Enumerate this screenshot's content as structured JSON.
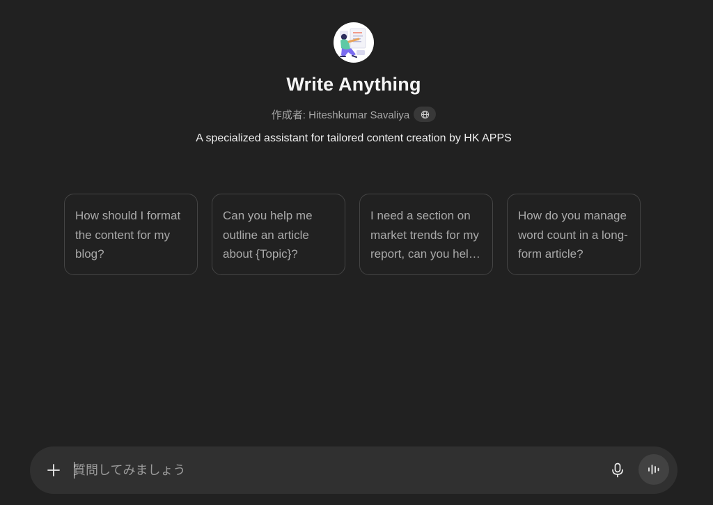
{
  "gpt": {
    "name": "Write Anything",
    "author": "作成者: Hiteshkumar Savaliya",
    "description": "A specialized assistant for tailored content creation by HK APPS",
    "avatar_icon": "writer-illustration-icon",
    "globe_icon": "globe-icon"
  },
  "starters": [
    {
      "text": "How should I format the content for my blog?"
    },
    {
      "text": "Can you help me outline an article about {Topic}?"
    },
    {
      "text": "I need a section on market trends for my report, can you help me write it?"
    },
    {
      "text": "How do you manage word count in a long-form article?"
    }
  ],
  "composer": {
    "placeholder": "質問してみましょう",
    "value": "",
    "plus_icon": "plus-icon",
    "mic_icon": "microphone-icon",
    "voice_icon": "voice-mode-icon"
  },
  "colors": {
    "background": "#212121",
    "card_border": "#444444",
    "composer_bg": "#303030",
    "voice_button_bg": "#424242"
  }
}
